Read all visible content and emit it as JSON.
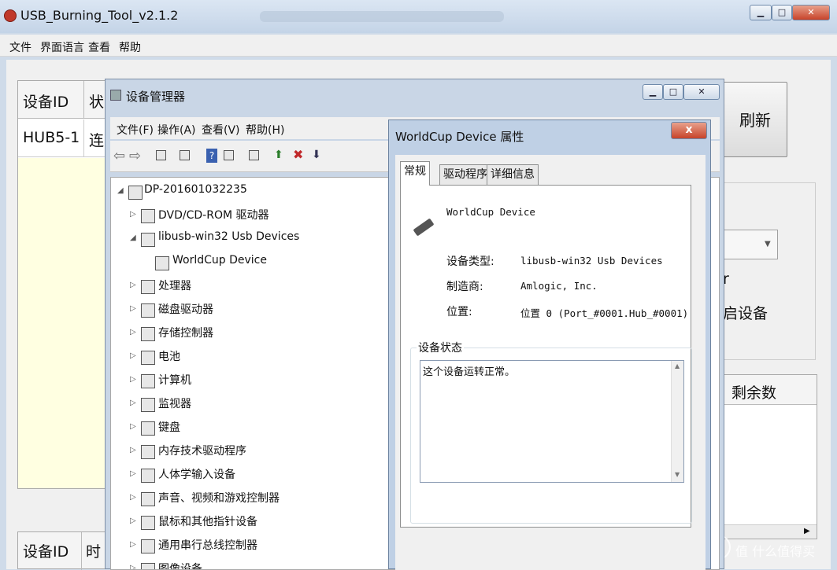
{
  "main_window": {
    "title": "USB_Burning_Tool_v2.1.2",
    "menu": [
      "文件",
      "界面语言",
      "查看",
      "帮助"
    ],
    "grid_headers": [
      "设备ID",
      "状"
    ],
    "grid_row": [
      "HUB5-1",
      "连"
    ],
    "refresh_label": "刷新",
    "partial_text_r": "r",
    "partial_text_device": "启设备",
    "remaining_header": "剩余数",
    "bottom_headers": [
      "设备ID",
      "时"
    ]
  },
  "device_manager": {
    "title": "设备管理器",
    "menu": [
      "文件(F)",
      "操作(A)",
      "查看(V)",
      "帮助(H)"
    ],
    "root": "DP-201601032235",
    "tree": [
      {
        "label": "DVD/CD-ROM 驱动器",
        "expanded": false,
        "level": 1
      },
      {
        "label": "libusb-win32 Usb Devices",
        "expanded": true,
        "level": 1
      },
      {
        "label": "WorldCup Device",
        "expanded": false,
        "level": 2
      },
      {
        "label": "处理器",
        "expanded": false,
        "level": 1
      },
      {
        "label": "磁盘驱动器",
        "expanded": false,
        "level": 1
      },
      {
        "label": "存储控制器",
        "expanded": false,
        "level": 1
      },
      {
        "label": "电池",
        "expanded": false,
        "level": 1
      },
      {
        "label": "计算机",
        "expanded": false,
        "level": 1
      },
      {
        "label": "监视器",
        "expanded": false,
        "level": 1
      },
      {
        "label": "键盘",
        "expanded": false,
        "level": 1
      },
      {
        "label": "内存技术驱动程序",
        "expanded": false,
        "level": 1
      },
      {
        "label": "人体学输入设备",
        "expanded": false,
        "level": 1
      },
      {
        "label": "声音、视频和游戏控制器",
        "expanded": false,
        "level": 1
      },
      {
        "label": "鼠标和其他指针设备",
        "expanded": false,
        "level": 1
      },
      {
        "label": "通用串行总线控制器",
        "expanded": false,
        "level": 1
      },
      {
        "label": "图像设备",
        "expanded": false,
        "level": 1
      }
    ]
  },
  "properties": {
    "title": "WorldCup Device 属性",
    "close_label": "x",
    "tabs": [
      "常规",
      "驱动程序",
      "详细信息"
    ],
    "device_name": "WorldCup Device",
    "fields": [
      {
        "label": "设备类型:",
        "value": "libusb-win32 Usb Devices"
      },
      {
        "label": "制造商:",
        "value": "Amlogic, Inc."
      },
      {
        "label": "位置:",
        "value": "位置 0 (Port_#0001.Hub_#0001)"
      }
    ],
    "status_group": "设备状态",
    "status_text": "这个设备运转正常。"
  },
  "watermark": "值 什么值得买"
}
